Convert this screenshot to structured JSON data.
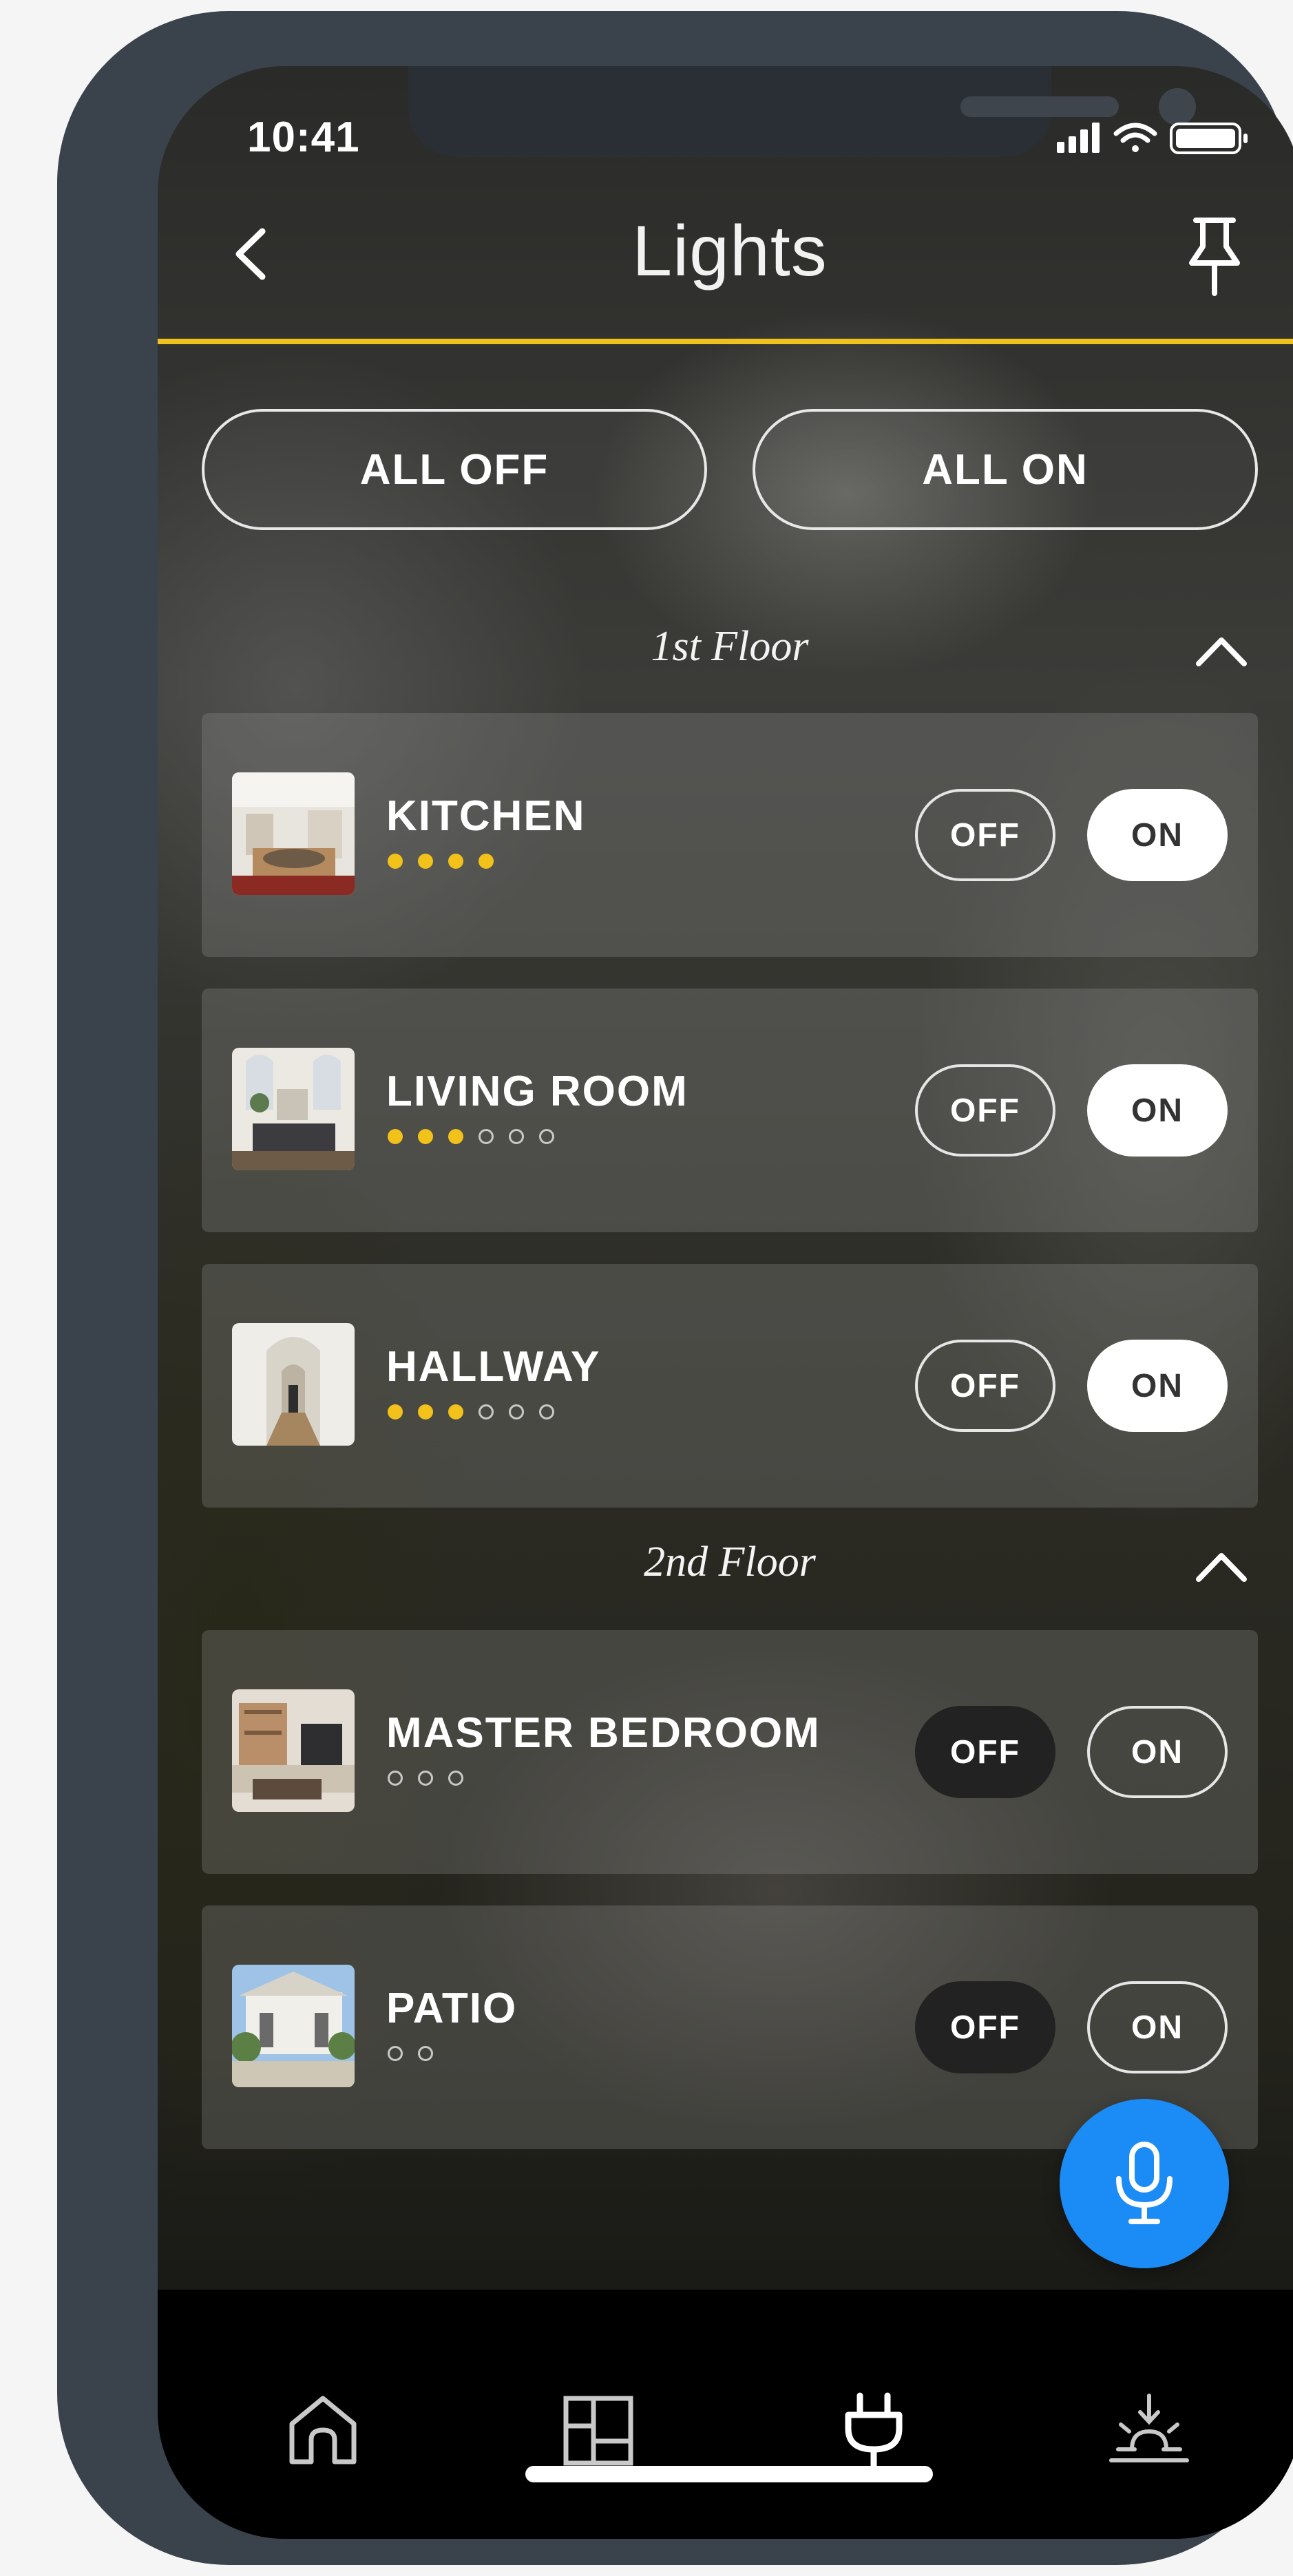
{
  "status_bar": {
    "time": "10:41"
  },
  "header": {
    "title": "Lights"
  },
  "controls": {
    "all_off": "ALL OFF",
    "all_on": "ALL ON"
  },
  "floors": [
    {
      "label": "1st Floor",
      "rooms": [
        {
          "name": "KITCHEN",
          "brightness_on": 4,
          "brightness_total": 4,
          "state": "on",
          "off_label": "OFF",
          "on_label": "ON"
        },
        {
          "name": "LIVING ROOM",
          "brightness_on": 3,
          "brightness_total": 6,
          "state": "on",
          "off_label": "OFF",
          "on_label": "ON"
        },
        {
          "name": "HALLWAY",
          "brightness_on": 3,
          "brightness_total": 6,
          "state": "on",
          "off_label": "OFF",
          "on_label": "ON"
        }
      ]
    },
    {
      "label": "2nd Floor",
      "rooms": [
        {
          "name": "MASTER BEDROOM",
          "brightness_on": 0,
          "brightness_total": 3,
          "state": "off",
          "off_label": "OFF",
          "on_label": "ON"
        },
        {
          "name": "PATIO",
          "brightness_on": 0,
          "brightness_total": 2,
          "state": "off",
          "off_label": "OFF",
          "on_label": "ON"
        }
      ]
    }
  ],
  "tabs": [
    {
      "icon": "home-icon",
      "active": false
    },
    {
      "icon": "rooms-layout-icon",
      "active": false
    },
    {
      "icon": "plug-icon",
      "active": true
    },
    {
      "icon": "scenes-sunrise-icon",
      "active": false
    }
  ],
  "colors": {
    "accent": "#f0c21e",
    "fab": "#1b8bf5",
    "dot_on": "#f2c21b",
    "frame": "#3a424c"
  }
}
